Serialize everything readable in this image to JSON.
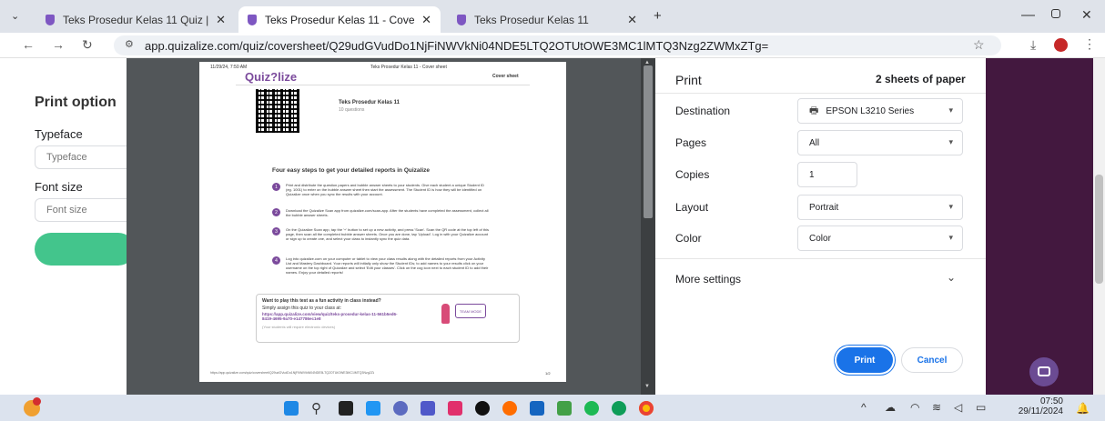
{
  "browser": {
    "tabs": [
      {
        "label": "Teks Prosedur Kelas 11 Quiz | Q"
      },
      {
        "label": "Teks Prosedur Kelas 11 - Cover"
      },
      {
        "label": "Teks Prosedur Kelas 11"
      }
    ],
    "url": "app.quizalize.com/quiz/coversheet/Q29udGVudDo1NjFiNWVkNi04NDE5LTQ2OTUtOWE3MC1lMTQ3Nzg2ZWMxZTg="
  },
  "page": {
    "heading": "Print option",
    "typeface_label": "Typeface",
    "typeface_placeholder": "Typeface",
    "fontsize_label": "Font size",
    "fontsize_placeholder": "Font size"
  },
  "preview": {
    "header_date": "11/29/24, 7:50 AM",
    "header_title": "Teks Prosedur Kelas 11 - Cover sheet",
    "logo": "Quiz?lize",
    "cover_label": "Cover sheet",
    "quiz_title": "Teks Prosedur Kelas 11",
    "quiz_sub": "10 questions",
    "steps_title": "Four easy steps to get your detailed reports in Quizalize",
    "steps": [
      {
        "n": "1",
        "text": "Print and distribute the question papers and bubble answer sheets to your students. Give each student a unique Student ID (eg. 1001) to enter on the bubble answer sheet then start the assessment. The Student ID is how they will be identified on Quizalize once when you sync the results with your account."
      },
      {
        "n": "2",
        "text": "Download the Quizalize Scan app from quizalize.com/scan-app. After the students have completed the assessment, collect all the bubble answer sheets."
      },
      {
        "n": "3",
        "text": "On the Quizalize Scan app, tap the '+' button to set up a new activity, and press 'Scan'. Scan the QR code at the top left of this page, then scan all the completed bubble answer sheets. Once you are done, tap 'Upload'. Log in with your Quizalize account or sign up to create one, and select your class to instantly sync the quiz data."
      },
      {
        "n": "4",
        "text": "Log into quizalize.com on your computer or tablet to view your class results along with the detailed reports from your Activity List and Mastery Dashboard. Your reports will initially only show the Student IDs; to add names to your results click on your username on the top right of Quizalize and select 'Edit your classes'. Click on the cog icon next to each student ID to add their names. Enjoy your detailed reports!"
      }
    ],
    "fun_title": "Want to play this test as a fun activity in class instead?",
    "fun_sub": "Simply assign this quiz to your class at:",
    "fun_link": "https://app.quizalize.com/view/quiz/teks-prosedur-kelas-11-561b5ed6-8419-4695-9a70-e147786ec1e8",
    "fun_note": "(Your students will require electronic devices)",
    "fun_badge": "TEAM MODE",
    "footer_url": "https://app.quizalize.com/quiz/coversheet/Q29udGVudDo1NjFiNWVkNi04NDE5LTQ2OTUtOWE3MC1lMTQ3Nzg2ZWMxZTg=",
    "footer_page": "1/2"
  },
  "dialog": {
    "title": "Print",
    "sheets": "2 sheets of paper",
    "destination_label": "Destination",
    "destination_value": "EPSON L3210 Series",
    "pages_label": "Pages",
    "pages_value": "All",
    "copies_label": "Copies",
    "copies_value": "1",
    "layout_label": "Layout",
    "layout_value": "Portrait",
    "color_label": "Color",
    "color_value": "Color",
    "more_settings": "More settings",
    "print_btn": "Print",
    "cancel_btn": "Cancel"
  },
  "taskbar": {
    "time": "07:50",
    "date": "29/11/2024"
  },
  "colors": {
    "accent": "#1a73e8",
    "brand": "#7b4a9c",
    "purple_panel": "#43183f",
    "green": "#43c58c"
  }
}
